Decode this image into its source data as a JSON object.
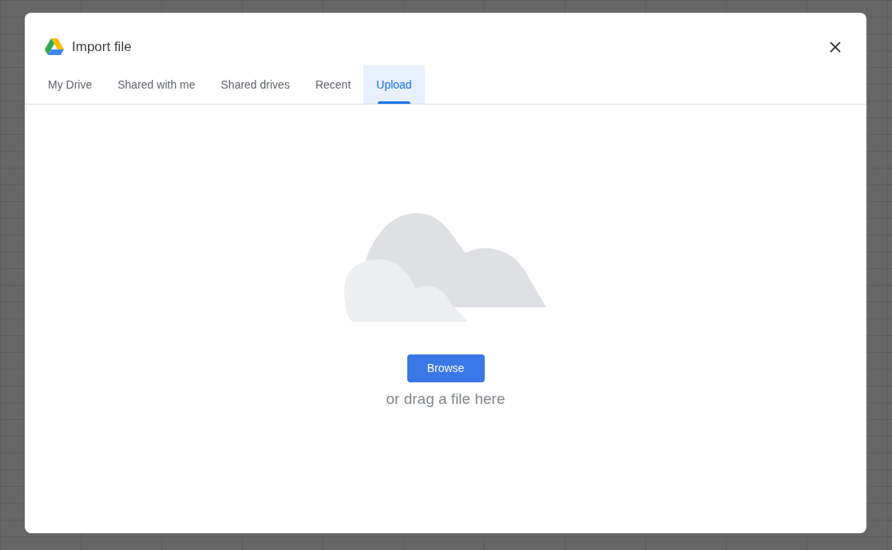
{
  "dialog": {
    "title": "Import file"
  },
  "tabs": [
    {
      "label": "My Drive",
      "selected": false
    },
    {
      "label": "Shared with me",
      "selected": false
    },
    {
      "label": "Shared drives",
      "selected": false
    },
    {
      "label": "Recent",
      "selected": false
    },
    {
      "label": "Upload",
      "selected": true
    }
  ],
  "upload": {
    "button": "Browse",
    "hint": "or drag a file here"
  }
}
